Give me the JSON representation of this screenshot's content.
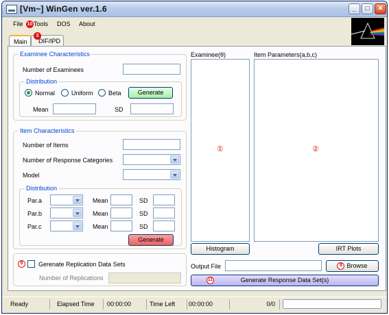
{
  "window": {
    "title": "[Vm~] WinGen ver.1.6",
    "minimize": "_",
    "maximize": "□",
    "close": "✕"
  },
  "menu": {
    "file": "File",
    "tools": "Tools",
    "dos": "DOS",
    "about": "About"
  },
  "markers": {
    "m1": "①",
    "m2": "②",
    "m3": "3",
    "m8": "8",
    "m9": "9",
    "m10": "10",
    "m11": "11"
  },
  "tabs": {
    "main": "Main",
    "dif": "DIF/IPD"
  },
  "examinee": {
    "legend": "Examinee Characteristics",
    "num_label": "Number of Examinees",
    "num_value": "",
    "dist_legend": "Distribution",
    "normal": "Normal",
    "uniform": "Uniform",
    "beta": "Beta",
    "selected": "Normal",
    "generate": "Generate",
    "mean_label": "Mean",
    "mean_value": "",
    "sd_label": "SD",
    "sd_value": ""
  },
  "item": {
    "legend": "Item Characteristics",
    "num_items_label": "Number of Items",
    "num_items_value": "",
    "num_cat_label": "Number of Response Categories",
    "num_cat_value": "",
    "model_label": "Model",
    "model_value": "",
    "dist_legend": "Distribution",
    "rows": [
      {
        "label": "Par.a",
        "mean_label": "Mean",
        "sd_label": "SD"
      },
      {
        "label": "Par.b",
        "mean_label": "Mean",
        "sd_label": "SD"
      },
      {
        "label": "Par.c",
        "mean_label": "Mean",
        "sd_label": "SD"
      }
    ],
    "generate": "Generate"
  },
  "replication": {
    "checkbox_label": "Gerenate Replication Data Sets",
    "num_label": "Number of Replications",
    "num_value": ""
  },
  "right": {
    "examinee_label": "Examinee(θ)",
    "items_label": "Item Parameters(a,b,c)",
    "histogram": "Histogram",
    "irt_plots": "IRT Plots",
    "output_label": "Output File",
    "output_value": "",
    "browse": "Browse",
    "generate_response": "Generate Response Data Set(s)"
  },
  "status": {
    "ready": "Ready",
    "elapsed_label": "Elapsed Time",
    "elapsed": "00:00:00",
    "left_label": "Time Left",
    "left": "00:00:00",
    "count": "0/0",
    "progress": 0
  },
  "colors": {
    "legend": "#0046d5",
    "marker": "#e01010",
    "generate_green": "#a6eea6",
    "generate_red": "#ef6060",
    "generate_purple": "#b9b3f0"
  }
}
